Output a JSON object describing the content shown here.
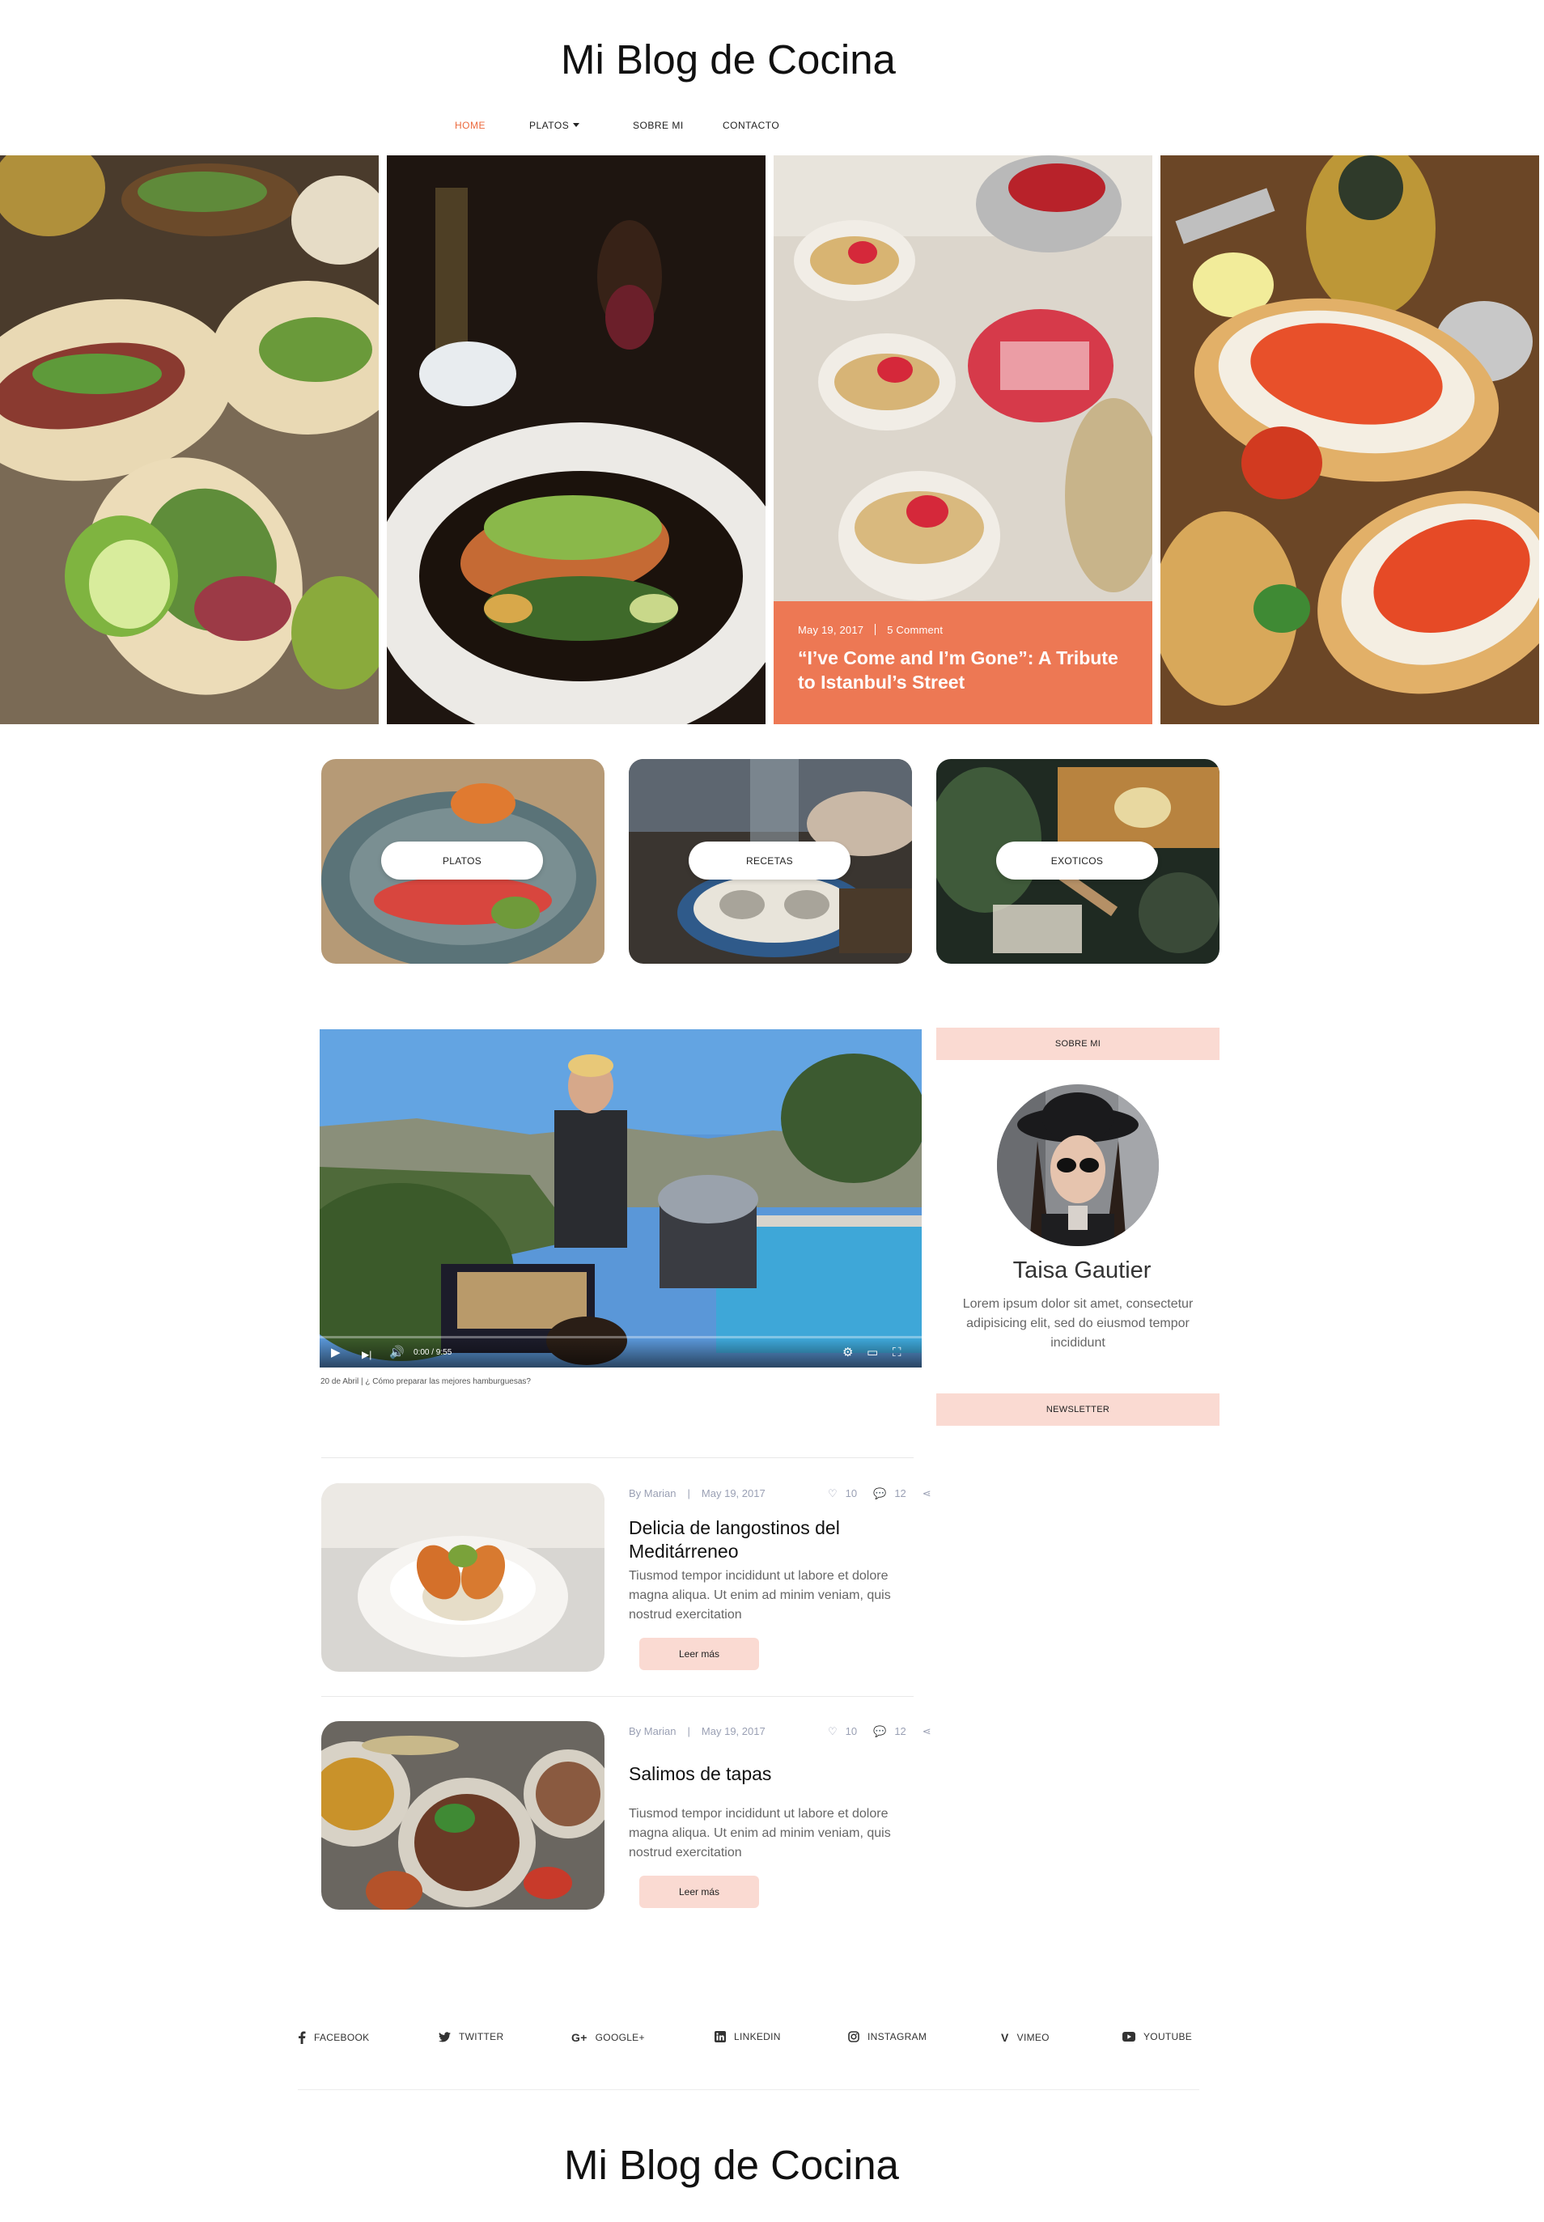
{
  "header": {
    "site_title": "Mi Blog de Cocina"
  },
  "nav": {
    "items": [
      {
        "label": "HOME",
        "active": true
      },
      {
        "label": "PLATOS",
        "dropdown": true
      },
      {
        "label": "SOBRE MI"
      },
      {
        "label": "CONTACTO"
      }
    ]
  },
  "hero": {
    "featured": {
      "date": "May 19, 2017",
      "comments": "5 Comment",
      "title": "“I’ve Come and I’m Gone”: A Tribute to Istanbul’s Street"
    }
  },
  "categories": [
    "PLATOS",
    "RECETAS",
    "EXOTICOS"
  ],
  "video": {
    "time": "0:00 / 9:55",
    "caption": "20 de Abril | ¿ Cómo preparar las mejores hamburguesas?"
  },
  "sidebar": {
    "about_heading": "SOBRE MI",
    "author_name": "Taisa Gautier",
    "author_bio": "Lorem ipsum dolor sit amet, consectetur adipisicing elit, sed do eiusmod tempor incididunt",
    "newsletter_heading": "NEWSLETTER"
  },
  "posts": [
    {
      "author": "By Marian",
      "date": "May 19, 2017",
      "likes": "10",
      "comments": "12",
      "title": "Delicia de langostinos del Meditárreneo",
      "excerpt": "Tiusmod tempor incididunt ut labore et dolore magna aliqua. Ut enim ad minim veniam, quis nostrud exercitation",
      "button": "Leer más"
    },
    {
      "author": "By Marian",
      "date": "May 19, 2017",
      "likes": "10",
      "comments": "12",
      "title": "Salimos de tapas",
      "excerpt": "Tiusmod tempor incididunt ut labore et dolore magna aliqua. Ut enim ad minim veniam, quis nostrud exercitation",
      "button": "Leer más"
    }
  ],
  "social": [
    {
      "label": "FACEBOOK",
      "icon": "facebook-icon"
    },
    {
      "label": "TWITTER",
      "icon": "twitter-icon"
    },
    {
      "label": "GOOGLE+",
      "icon": "google-plus-icon"
    },
    {
      "label": "LINKEDIN",
      "icon": "linkedin-icon"
    },
    {
      "label": "INSTAGRAM",
      "icon": "instagram-icon"
    },
    {
      "label": "VIMEO",
      "icon": "vimeo-icon"
    },
    {
      "label": "YOUTUBE",
      "icon": "youtube-icon"
    }
  ],
  "footer": {
    "site_title": "Mi Blog de Cocina"
  },
  "colors": {
    "accent": "#ec6a3d",
    "overlay": "#ee704a",
    "pale_pink": "#fadad2",
    "muted": "#9aa0b4"
  }
}
